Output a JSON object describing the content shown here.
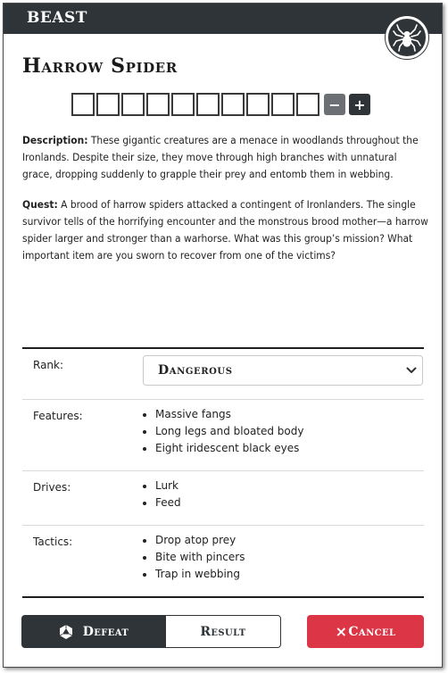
{
  "header": {
    "category": "BEAST",
    "emblem_icon": "spider-icon"
  },
  "title": "Harrow Spider",
  "progress": {
    "boxes": 10,
    "filled": 0,
    "minus_label": "−",
    "plus_label": "+"
  },
  "description": {
    "label": "Description:",
    "text": "These gigantic creatures are a menace in woodlands throughout the Ironlands. Despite their size, they move through high branches with unnatural grace, dropping suddenly to grapple their prey and entomb them in webbing."
  },
  "quest": {
    "label": "Quest:",
    "text": "A brood of harrow spiders attacked a contingent of Ironlanders. The single survivor tells of the horrifying encounter and the monstrous brood mother—a harrow spider larger and stronger than a warhorse. What was this group’s mission? What important item are you sworn to recover from one of the victims?"
  },
  "rank": {
    "label": "Rank:",
    "value": "Dangerous"
  },
  "features": {
    "label": "Features:",
    "items": [
      "Massive fangs",
      "Long legs and bloated body",
      "Eight iridescent black eyes"
    ]
  },
  "drives": {
    "label": "Drives:",
    "items": [
      "Lurk",
      "Feed"
    ]
  },
  "tactics": {
    "label": "Tactics:",
    "items": [
      "Drop atop prey",
      "Bite with pincers",
      "Trap in webbing"
    ]
  },
  "buttons": {
    "defeat": "Defeat",
    "result": "Result",
    "cancel": "Cancel",
    "cancel_icon": "×"
  },
  "colors": {
    "header": "#2f3438",
    "cancel": "#dc3545",
    "minus": "#6c7075"
  }
}
